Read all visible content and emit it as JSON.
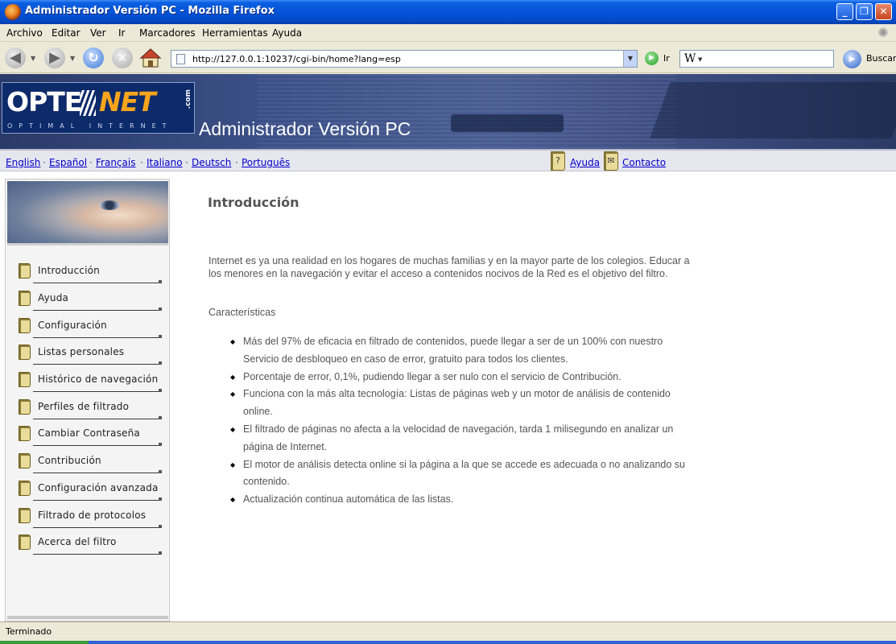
{
  "window": {
    "title": "Administrador Versión PC - Mozilla Firefox",
    "buttons": {
      "minimize": "_",
      "maximize": "❐",
      "close": "✕"
    }
  },
  "menubar": {
    "items": [
      "Archivo",
      "Editar",
      "Ver",
      "Ir",
      "Marcadores",
      "Herramientas",
      "Ayuda"
    ]
  },
  "navbar": {
    "url": "http://127.0.0.1:10237/cgi-bin/home?lang=esp",
    "go_label": "Ir",
    "search_engine_icon": "W",
    "search_value": "",
    "search_label": "Buscar"
  },
  "banner": {
    "logo_left": "OPTE",
    "logo_right": "NET",
    "logo_suffix": ".com",
    "logo_tagline": "OPTIMAL INTERNET",
    "title": "Administrador Versión PC"
  },
  "langbar": {
    "languages": [
      "English",
      "Español",
      "Français",
      "Italiano",
      "Deutsch",
      "Português"
    ],
    "separator": "·",
    "help_label": "Ayuda",
    "help_icon": "?",
    "contact_label": "Contacto",
    "contact_icon": "✉"
  },
  "sidebar": {
    "items": [
      "Introducción",
      "Ayuda",
      "Configuración",
      "Listas personales",
      "Histórico de navegación",
      "Perfiles de filtrado",
      "Cambiar Contraseña",
      "Contribución",
      "Configuración avanzada",
      "Filtrado de protocolos",
      "Acerca del filtro"
    ]
  },
  "content": {
    "heading": "Introducción",
    "intro": "Internet es ya una realidad en los hogares de muchas familias y en la mayor parte de los colegios. Educar a los menores en la navegación y evitar el acceso a contenidos nocivos de la Red es el objetivo del filtro.",
    "features_title": "Características",
    "features": [
      "Más del 97% de eficacia en filtrado de contenidos, puede llegar a ser de un 100% con nuestro Servicio de desbloqueo en caso de error, gratuito para todos los clientes.",
      "Porcentaje de error, 0,1%, pudiendo llegar a ser nulo con el servicio de Contribución.",
      "Funciona con la más alta tecnología: Listas de páginas web y un motor de análisis de contenido online.",
      "El filtrado de páginas no afecta a la velocidad de navegación, tarda 1 milisegundo en analizar un página de Internet.",
      "El motor de análisis detecta online si la página a la que se accede es adecuada o no analizando su contenido.",
      "Actualización continua automática de las listas."
    ]
  },
  "statusbar": {
    "text": "Terminado"
  }
}
